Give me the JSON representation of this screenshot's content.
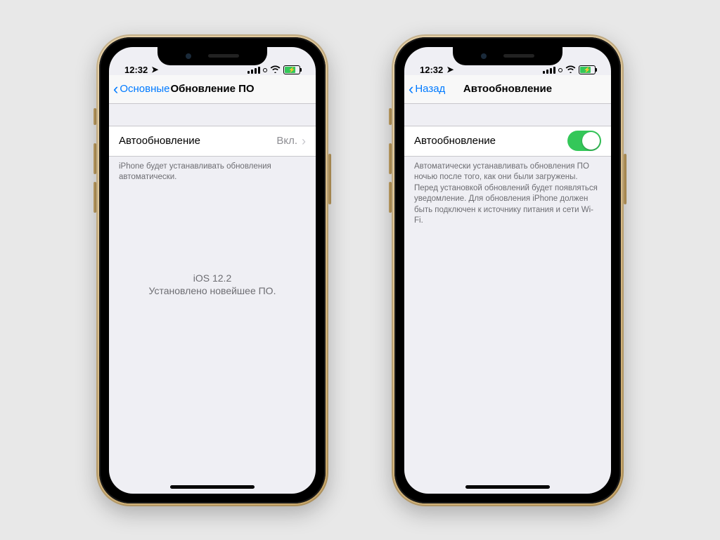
{
  "status": {
    "time": "12:32"
  },
  "left": {
    "nav": {
      "back": "Основные",
      "title": "Обновление ПО"
    },
    "cell": {
      "label": "Автообновление",
      "value": "Вкл."
    },
    "footer": "iPhone будет устанавливать обновления автоматически.",
    "center": {
      "version": "iOS 12.2",
      "message": "Установлено новейшее ПО."
    }
  },
  "right": {
    "nav": {
      "back": "Назад",
      "title": "Автообновление"
    },
    "cell": {
      "label": "Автообновление",
      "switch_on": true
    },
    "footer": "Автоматически устанавливать обновления ПО ночью после того, как они были загружены. Перед установкой обновлений будет появляться уведомление. Для обновления iPhone должен быть подключен к источнику питания и сети Wi-Fi."
  }
}
